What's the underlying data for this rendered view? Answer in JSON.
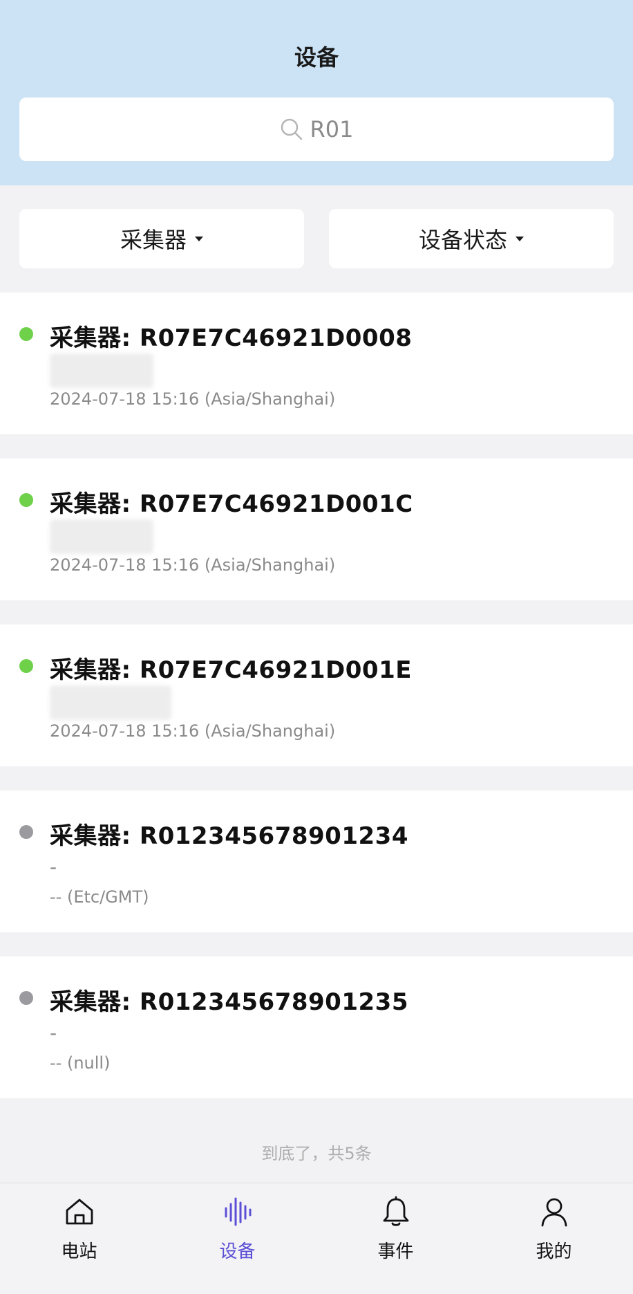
{
  "header": {
    "title": "设备"
  },
  "search": {
    "value": "R01"
  },
  "filters": [
    {
      "label": "采集器"
    },
    {
      "label": "设备状态"
    }
  ],
  "devices": [
    {
      "title": "采集器: R07E7C46921D0008",
      "subtitle": "",
      "time": "2024-07-18 15:16 (Asia/Shanghai)",
      "status_color": "#6fd14a"
    },
    {
      "title": "采集器: R07E7C46921D001C",
      "subtitle": "",
      "time": "2024-07-18 15:16 (Asia/Shanghai)",
      "status_color": "#6fd14a"
    },
    {
      "title": "采集器: R07E7C46921D001E",
      "subtitle": "",
      "time": "2024-07-18 15:16 (Asia/Shanghai)",
      "status_color": "#6fd14a"
    },
    {
      "title": "采集器: R012345678901234",
      "subtitle": "-",
      "time": "-- (Etc/GMT)",
      "status_color": "#9a9a9f"
    },
    {
      "title": "采集器: R012345678901235",
      "subtitle": "-",
      "time": "-- (null)",
      "status_color": "#9a9a9f"
    }
  ],
  "list_footer": "到底了，共5条",
  "tabbar": {
    "items": [
      {
        "label": "电站",
        "icon": "home-icon"
      },
      {
        "label": "设备",
        "icon": "waveform-icon",
        "active": true
      },
      {
        "label": "事件",
        "icon": "bell-icon"
      },
      {
        "label": "我的",
        "icon": "person-icon"
      }
    ]
  },
  "colors": {
    "accent": "#5b4fd6",
    "header_bg": "#cbe3f5",
    "online": "#6fd14a",
    "offline": "#9a9a9f"
  }
}
